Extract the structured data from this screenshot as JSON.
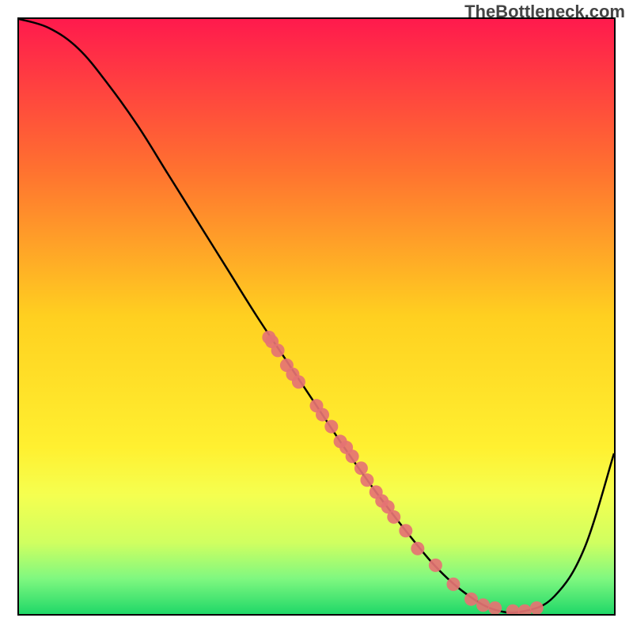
{
  "header": {
    "source": "TheBottleneck.com"
  },
  "chart_data": {
    "type": "line",
    "title": "",
    "xlabel": "",
    "ylabel": "",
    "xlim": [
      0,
      100
    ],
    "ylim": [
      0,
      100
    ],
    "series": [
      {
        "name": "curve",
        "x": [
          0,
          5,
          10,
          15,
          20,
          25,
          30,
          35,
          40,
          45,
          50,
          55,
          60,
          65,
          70,
          75,
          80,
          85,
          90,
          95,
          100
        ],
        "y": [
          100,
          98.5,
          95,
          89,
          82,
          74,
          66,
          58,
          50,
          42.5,
          35,
          27.5,
          20.5,
          14,
          8,
          3.5,
          0.7,
          0.5,
          3,
          11,
          27
        ]
      }
    ],
    "scatter_points": [
      {
        "x": 42,
        "y": 46.5
      },
      {
        "x": 42.5,
        "y": 45.8
      },
      {
        "x": 43.5,
        "y": 44.3
      },
      {
        "x": 45,
        "y": 41.8
      },
      {
        "x": 46,
        "y": 40.3
      },
      {
        "x": 47,
        "y": 39
      },
      {
        "x": 50,
        "y": 35
      },
      {
        "x": 51,
        "y": 33.5
      },
      {
        "x": 52.5,
        "y": 31.5
      },
      {
        "x": 54,
        "y": 29
      },
      {
        "x": 55,
        "y": 28
      },
      {
        "x": 56,
        "y": 26.5
      },
      {
        "x": 57.5,
        "y": 24.5
      },
      {
        "x": 58.5,
        "y": 22.5
      },
      {
        "x": 60,
        "y": 20.5
      },
      {
        "x": 61,
        "y": 19
      },
      {
        "x": 62,
        "y": 18
      },
      {
        "x": 63,
        "y": 16.3
      },
      {
        "x": 65,
        "y": 14
      },
      {
        "x": 67,
        "y": 11
      },
      {
        "x": 70,
        "y": 8.2
      },
      {
        "x": 73,
        "y": 5
      },
      {
        "x": 76,
        "y": 2.5
      },
      {
        "x": 78,
        "y": 1.5
      },
      {
        "x": 80,
        "y": 1
      },
      {
        "x": 83,
        "y": 0.5
      },
      {
        "x": 85,
        "y": 0.5
      },
      {
        "x": 87,
        "y": 1
      }
    ],
    "background_gradient": {
      "top": "#ff1a4d",
      "upper_mid": "#ff8030",
      "mid": "#ffd020",
      "lower_mid": "#fff030",
      "low": "#c8ff60",
      "bottom": "#28e070"
    }
  }
}
